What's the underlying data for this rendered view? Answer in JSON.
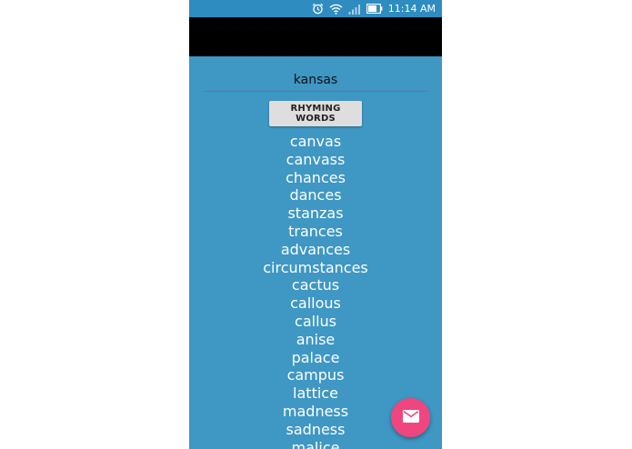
{
  "status_bar": {
    "time": "11:14 AM",
    "icons": [
      "alarm-icon",
      "wifi-icon",
      "signal-icon",
      "battery-icon"
    ]
  },
  "search": {
    "value": "kansas",
    "placeholder": ""
  },
  "actions": {
    "rhyme_button_label": "RHYMING WORDS",
    "fab_icon": "email-icon"
  },
  "rhymes": [
    "canvas",
    "canvass",
    "chances",
    "dances",
    "stanzas",
    "trances",
    "advances",
    "circumstances",
    "cactus",
    "callous",
    "callus",
    "anise",
    "palace",
    "campus",
    "lattice",
    "madness",
    "sadness",
    "malice"
  ],
  "colors": {
    "background": "#3f97c4",
    "status_bar": "#2f8cc0",
    "app_bar": "#000000",
    "input_underline": "#d6456b",
    "fab": "#f0467f"
  }
}
